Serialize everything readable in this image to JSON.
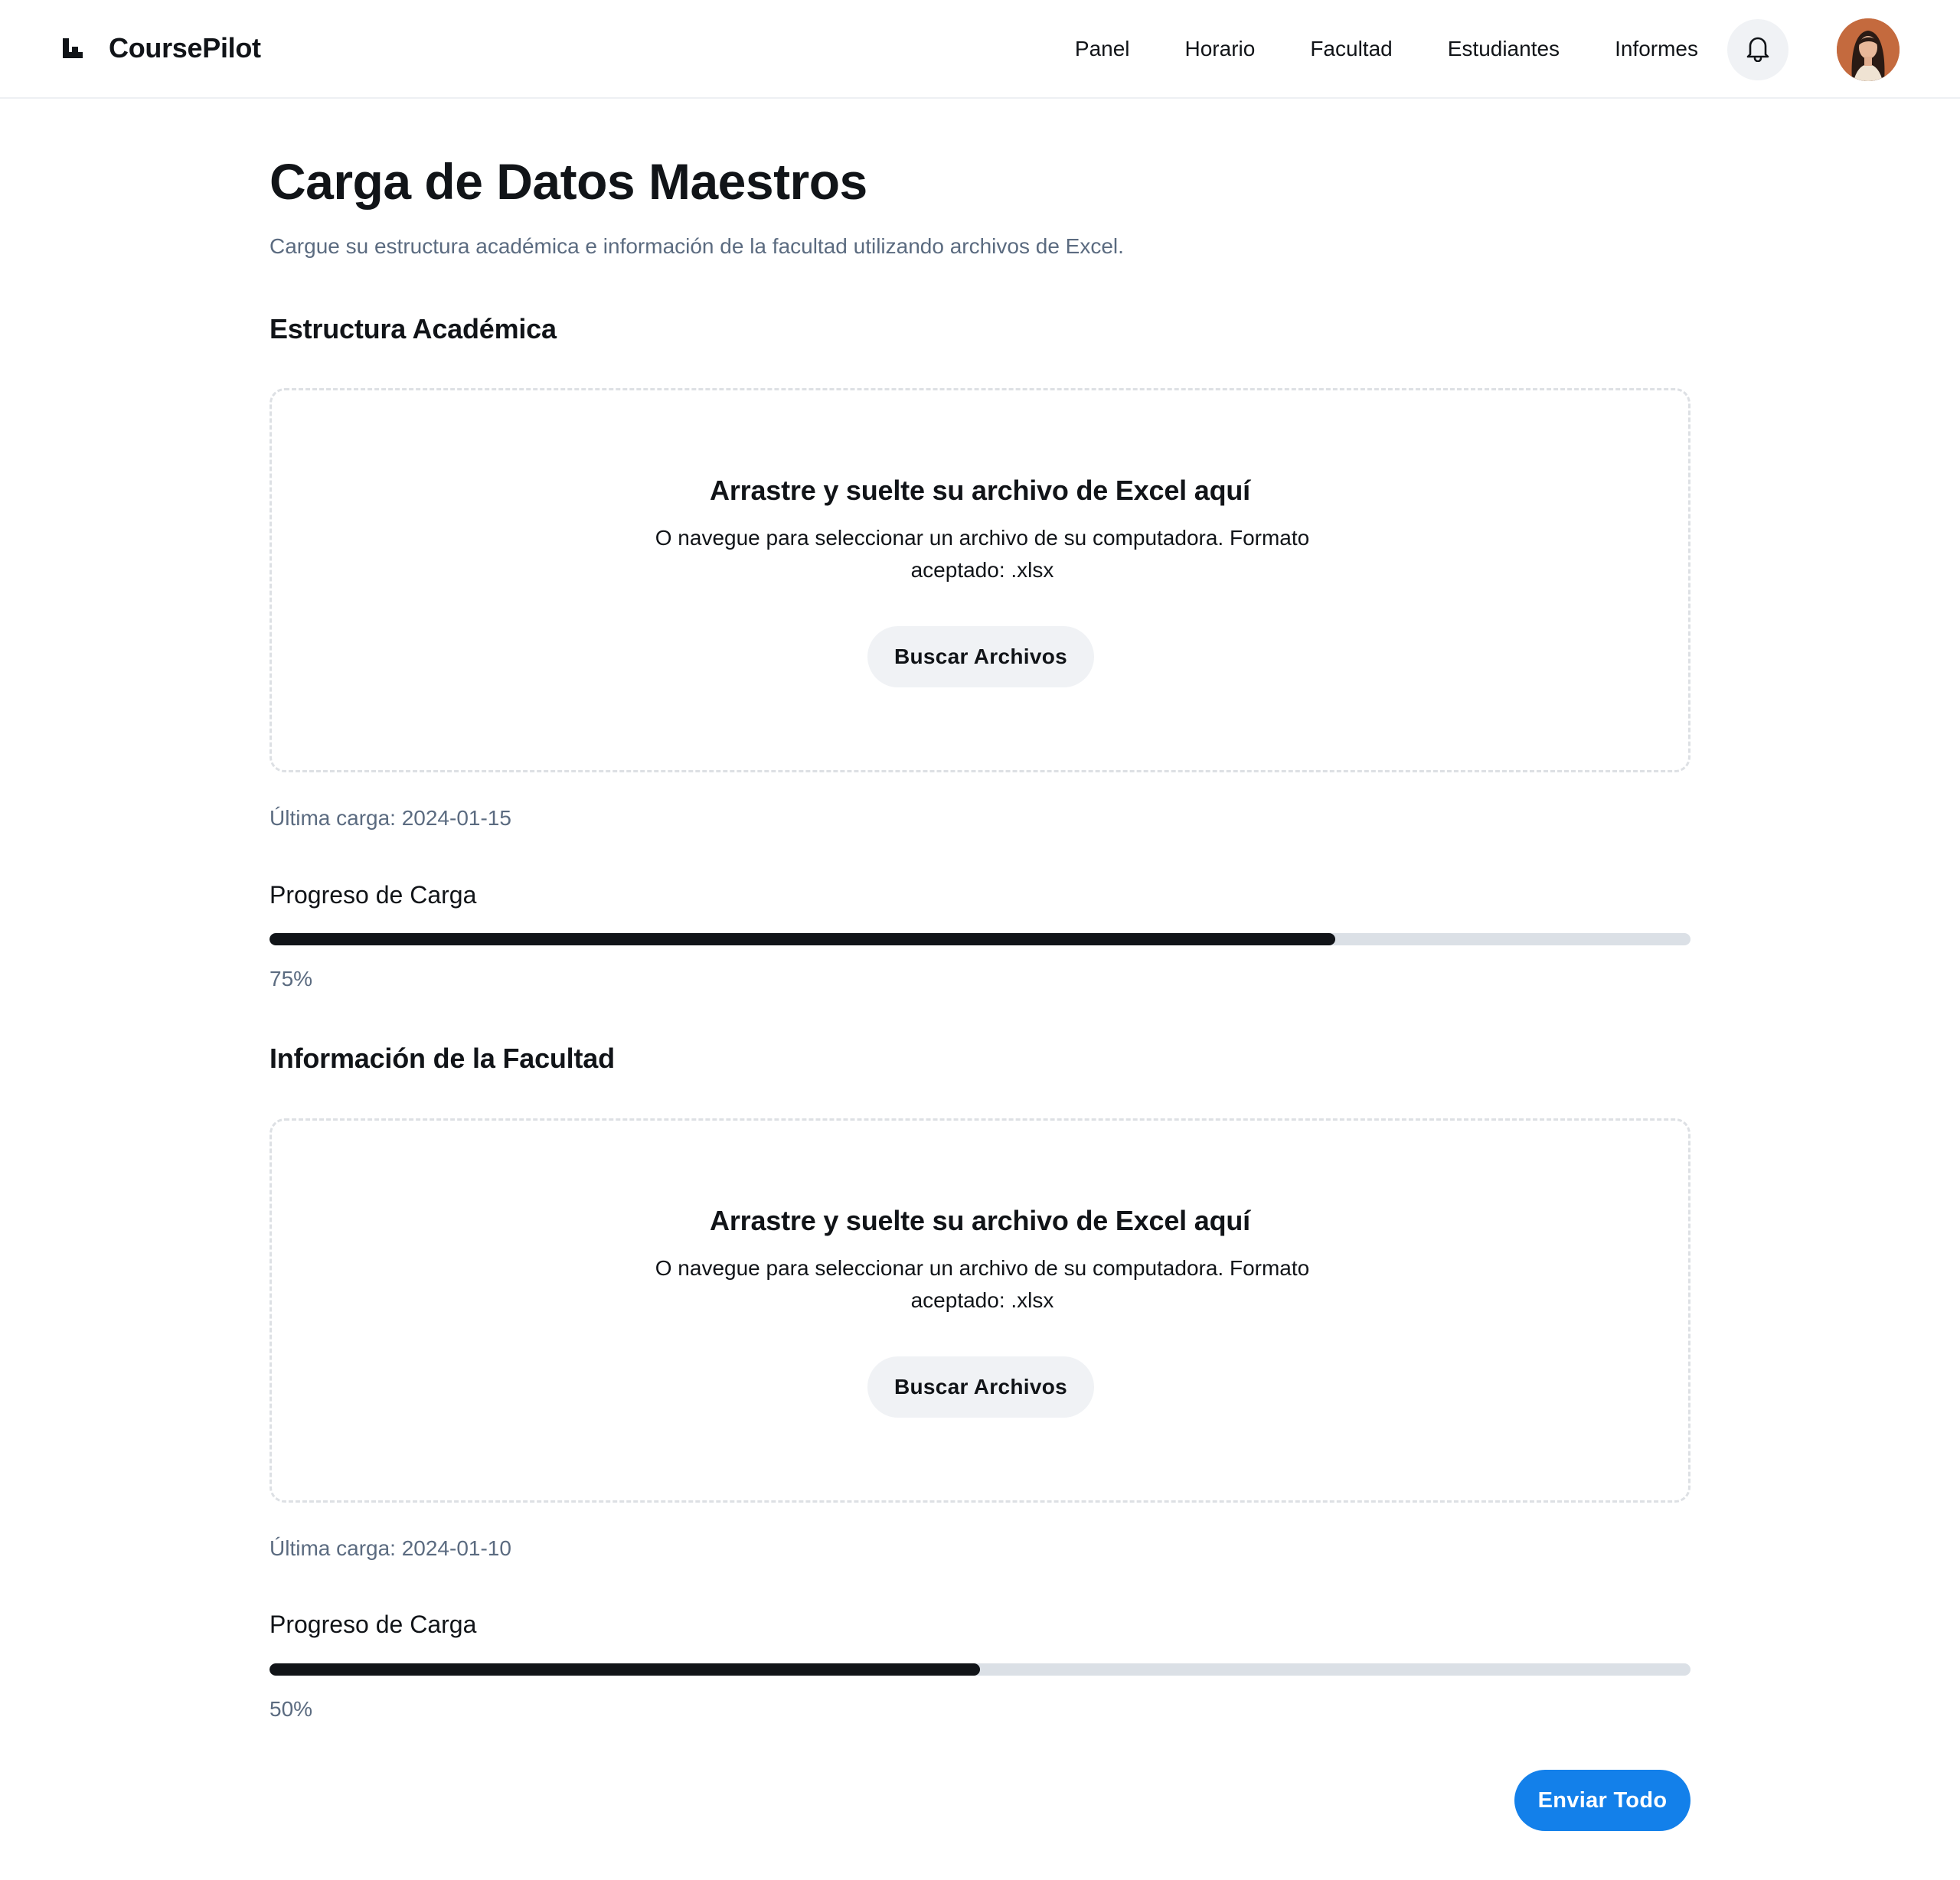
{
  "app": {
    "name": "CoursePilot"
  },
  "nav": {
    "items": [
      {
        "label": "Panel"
      },
      {
        "label": "Horario"
      },
      {
        "label": "Facultad"
      },
      {
        "label": "Estudiantes"
      },
      {
        "label": "Informes"
      }
    ],
    "notifications_icon": "bell-icon"
  },
  "page": {
    "title": "Carga de Datos Maestros",
    "subtitle": "Cargue su estructura académica e información de la facultad utilizando archivos de Excel."
  },
  "sections": [
    {
      "title": "Estructura Académica",
      "dropzone": {
        "title": "Arrastre y suelte su archivo de Excel aquí",
        "description": "O navegue para seleccionar un archivo de su computadora. Formato aceptado: .xlsx",
        "button_label": "Buscar Archivos"
      },
      "last_upload": "Última carga: 2024-01-15",
      "progress_label": "Progreso de Carga",
      "progress_value": 0.75,
      "progress_text": "75%"
    },
    {
      "title": "Información de la Facultad",
      "dropzone": {
        "title": "Arrastre y suelte su archivo de Excel aquí",
        "description": "O navegue para seleccionar un archivo de su computadora. Formato aceptado: .xlsx",
        "button_label": "Buscar Archivos"
      },
      "last_upload": "Última carga: 2024-01-10",
      "progress_label": "Progreso de Carga",
      "progress_value": 0.5,
      "progress_text": "50%"
    }
  ],
  "actions": {
    "submit_label": "Enviar Todo"
  },
  "colors": {
    "primary": "#1380ea",
    "text": "#111418",
    "muted": "#5b6b80",
    "progress_track": "#dbe0e6",
    "button_bg": "#f0f2f5"
  }
}
